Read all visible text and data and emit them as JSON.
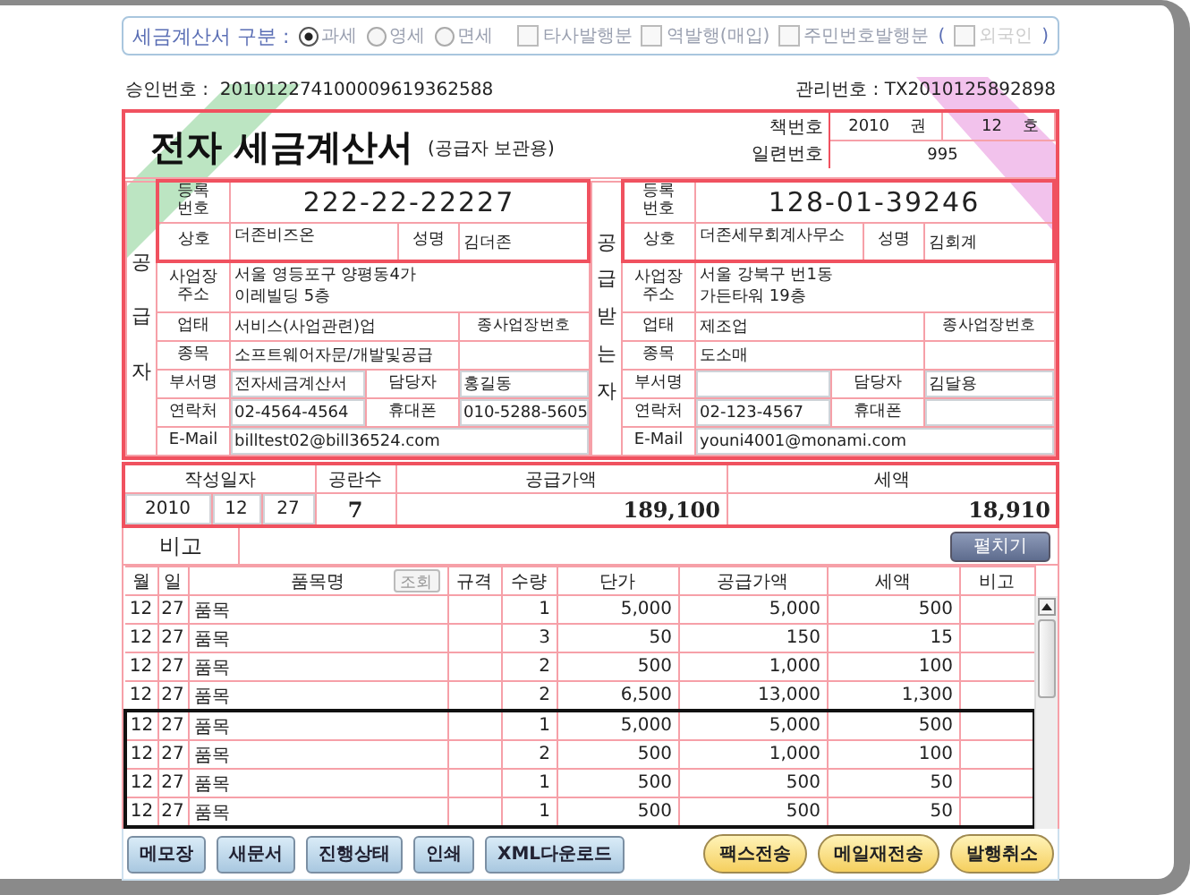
{
  "type_bar": {
    "label": "세금계산서 구분 :",
    "tax_types": [
      {
        "label": "과세",
        "selected": true
      },
      {
        "label": "영세",
        "selected": false
      },
      {
        "label": "면세",
        "selected": false
      }
    ],
    "options": [
      {
        "label": "타사발행분",
        "checked": false
      },
      {
        "label": "역발행(매입)",
        "checked": false
      },
      {
        "label": "주민번호발행분",
        "checked": false
      }
    ],
    "paren_open": "(",
    "foreign": {
      "label": "외국인",
      "checked": false,
      "disabled": true
    },
    "paren_close": ")"
  },
  "approval": {
    "label": "승인번호 :",
    "value": "201012274100009619362588"
  },
  "management": {
    "label": "관리번호 :",
    "value": "TX2010125892898"
  },
  "title": "전자 세금계산서",
  "subtitle": "(공급자 보관용)",
  "book": {
    "label": "책번호",
    "volume": "2010",
    "volume_unit": "권",
    "number": "12",
    "number_unit": "호"
  },
  "serial": {
    "label": "일련번호",
    "value": "995"
  },
  "parties": [
    {
      "side_label": "공급자",
      "reg_label": "등록번호",
      "reg_no": "222-22-22227",
      "name_label": "상호",
      "name": "더존비즈온",
      "rep_label": "성명",
      "rep": "김더존",
      "addr_label": "사업장주소",
      "addr_lines": [
        "서울 영등포구 양평동4가",
        "이레빌딩 5층"
      ],
      "biz_type_label": "업태",
      "biz_type": "서비스(사업관련)업",
      "branch_label": "종사업장번호",
      "item_label": "종목",
      "item": "소프트웨어자문/개발및공급",
      "dept_label": "부서명",
      "dept": "전자세금계산서",
      "contact_label": "담당자",
      "contact": "홍길동",
      "phone_label": "연락처",
      "phone": "02-4564-4564",
      "mobile_label": "휴대폰",
      "mobile": "010-5288-5605",
      "email_label": "E-Mail",
      "email": "billtest02@bill36524.com"
    },
    {
      "side_label": "공급받는자",
      "reg_label": "등록번호",
      "reg_no": "128-01-39246",
      "name_label": "상호",
      "name": "더존세무회계사무소",
      "rep_label": "성명",
      "rep": "김회계",
      "addr_label": "사업장주소",
      "addr_lines": [
        "서울 강북구 번1동",
        "가든타워  19층"
      ],
      "biz_type_label": "업태",
      "biz_type": "제조업",
      "branch_label": "종사업장번호",
      "item_label": "종목",
      "item": "도소매",
      "dept_label": "부서명",
      "contact_label": "담당자",
      "contact": "김달용",
      "phone_label": "연락처",
      "phone": "02-123-4567",
      "mobile_label": "휴대폰",
      "email_label": "E-Mail",
      "email": "youni4001@monami.com"
    }
  ],
  "totals": {
    "date_label": "작성일자",
    "blank_label": "공란수",
    "supply_label": "공급가액",
    "tax_label": "세액",
    "year": "2010",
    "month": "12",
    "day": "27",
    "blanks": "7",
    "supply": "189,100",
    "tax": "18,910"
  },
  "remarks": {
    "label": "비고",
    "button": "펼치기"
  },
  "items": {
    "columns": [
      "월",
      "일",
      "품목명",
      "규격",
      "수량",
      "단가",
      "공급가액",
      "세액",
      "비고"
    ],
    "lookup_button": "조회",
    "rows": [
      {
        "month": "12",
        "day": "27",
        "name": "품목",
        "qty": "1",
        "price": "5,000",
        "supply": "5,000",
        "tax": "500",
        "selected": false
      },
      {
        "month": "12",
        "day": "27",
        "name": "품목",
        "qty": "3",
        "price": "50",
        "supply": "150",
        "tax": "15",
        "selected": false
      },
      {
        "month": "12",
        "day": "27",
        "name": "품목",
        "qty": "2",
        "price": "500",
        "supply": "1,000",
        "tax": "100",
        "selected": false
      },
      {
        "month": "12",
        "day": "27",
        "name": "품목",
        "qty": "2",
        "price": "6,500",
        "supply": "13,000",
        "tax": "1,300",
        "selected": false
      },
      {
        "month": "12",
        "day": "27",
        "name": "품목",
        "qty": "1",
        "price": "5,000",
        "supply": "5,000",
        "tax": "500",
        "selected": true
      },
      {
        "month": "12",
        "day": "27",
        "name": "품목",
        "qty": "2",
        "price": "500",
        "supply": "1,000",
        "tax": "100",
        "selected": true
      },
      {
        "month": "12",
        "day": "27",
        "name": "품목",
        "qty": "1",
        "price": "500",
        "supply": "500",
        "tax": "50",
        "selected": true
      },
      {
        "month": "12",
        "day": "27",
        "name": "품목",
        "qty": "1",
        "price": "500",
        "supply": "500",
        "tax": "50",
        "selected": true
      }
    ]
  },
  "left_buttons": [
    "메모장",
    "새문서",
    "진행상태",
    "인쇄",
    "XML다운로드"
  ],
  "right_buttons": [
    "팩스전송",
    "메일재전송",
    "발행취소"
  ]
}
